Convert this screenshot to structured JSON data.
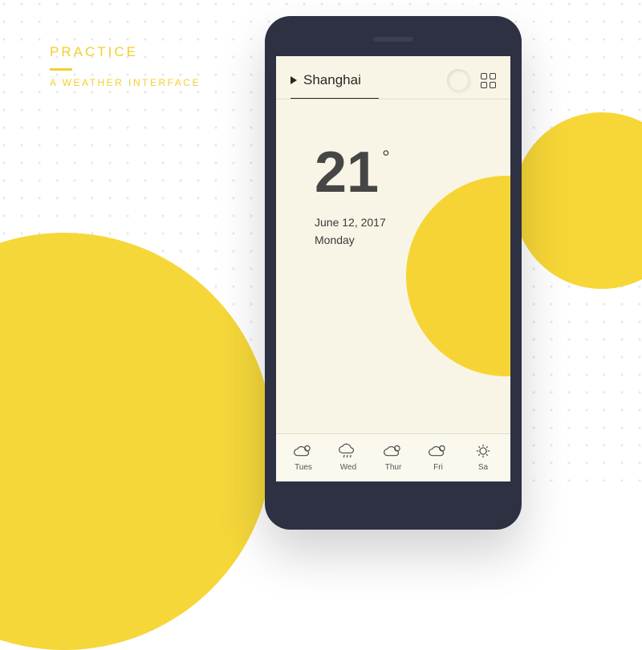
{
  "header": {
    "title": "PRACTICE",
    "subtitle": "A WEATHER INTERFACE"
  },
  "weather": {
    "city": "Shanghai",
    "temperature": "21",
    "degree_symbol": "°",
    "date": "June 12, 2017",
    "day_of_week": "Monday"
  },
  "forecast": [
    {
      "label": "Tues",
      "icon": "cloud-sun"
    },
    {
      "label": "Wed",
      "icon": "cloud-rain"
    },
    {
      "label": "Thur",
      "icon": "cloud-sun"
    },
    {
      "label": "Fri",
      "icon": "cloud-sun"
    },
    {
      "label": "Sa",
      "icon": "sun"
    }
  ],
  "colors": {
    "accent": "#f5d73a",
    "text": "#464646",
    "screen": "#f9f5e6",
    "phone": "#2e3142"
  }
}
